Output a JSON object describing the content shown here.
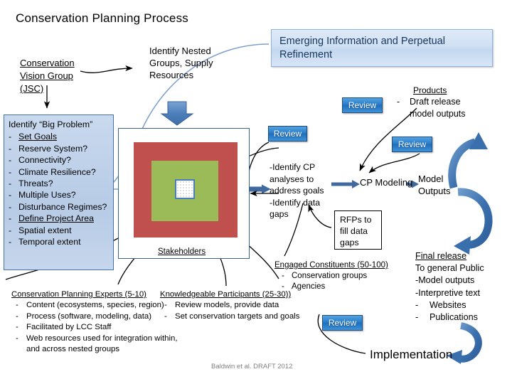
{
  "title": "Conservation Planning Process",
  "credit": "Baldwin et al. DRAFT 2012",
  "colors": {
    "red_square": "#C0504D",
    "green_square": "#9BBB59",
    "accent_blue": "#4A7EBB",
    "banner_text": "#16365C",
    "review_button": "#1F6FBE"
  },
  "vision_group": {
    "line1": "Conservation",
    "line2": "Vision Group",
    "line3": "(JSC)"
  },
  "nested_groups": {
    "line1": "Identify Nested",
    "line2": "Groups, Supply",
    "line3": "Resources"
  },
  "banner": {
    "text": "Emerging Information and Perpetual Refinement"
  },
  "big_problem": {
    "heading": "Identify “Big Problem”",
    "items": [
      {
        "dash": "-",
        "text": "Set Goals",
        "underline": true
      },
      {
        "dash": "-",
        "text": "Reserve System?",
        "underline": false
      },
      {
        "dash": "-",
        "text": "Connectivity?",
        "underline": false
      },
      {
        "dash": "-",
        "text": "Climate Resilience?",
        "underline": false
      },
      {
        "dash": "-",
        "text": "Threats?",
        "underline": false
      },
      {
        "dash": "-",
        "text": "Multiple Uses?",
        "underline": false
      },
      {
        "dash": "-",
        "text": "Disturbance Regimes?",
        "underline": false
      },
      {
        "dash": "-",
        "text": "Define Project Area",
        "underline": true
      },
      {
        "dash": "-",
        "text": "Spatial extent",
        "underline": false
      },
      {
        "dash": "-",
        "text": "Temporal extent",
        "underline": false
      }
    ]
  },
  "diagram": {
    "stakeholders_label": "Stakeholders"
  },
  "review_buttons": [
    {
      "label": "Review"
    },
    {
      "label": "Review"
    },
    {
      "label": "Review"
    },
    {
      "label": "Review"
    }
  ],
  "identify_cp": {
    "line1": "-Identify CP",
    "line2": "analyses to",
    "line3": "address goals",
    "line4": "-Identify data",
    "line5": "gaps"
  },
  "rfp_box": {
    "line1": "RFPs to",
    "line2": "fill data",
    "line3": "gaps"
  },
  "products": {
    "heading": "Products",
    "items": [
      {
        "dash": "-",
        "line1": "Draft release",
        "line2": "model outputs"
      }
    ]
  },
  "modeling": {
    "cp_modeling": "CP Modeling",
    "model_outputs_line1": "Model",
    "model_outputs_line2": "Outputs"
  },
  "engaged_constituents": {
    "heading": "Engaged Constituents (50-100)",
    "items": [
      {
        "dash": "-",
        "text": "Conservation groups"
      },
      {
        "dash": "-",
        "text": "Agencies"
      }
    ]
  },
  "final_release": {
    "heading": "Final release",
    "line1": "To general Public",
    "line2": "-Model outputs",
    "line3": "-Interpretive text",
    "items": [
      {
        "dash": "-",
        "text": "Websites"
      },
      {
        "dash": "-",
        "text": "Publications"
      }
    ]
  },
  "implementation": {
    "label": "Implementation"
  },
  "group_experts": {
    "heading": "Conservation Planning Experts (5-10)",
    "items": [
      {
        "dash": "-",
        "text": "Content (ecosystems, species, region)"
      },
      {
        "dash": "-",
        "text": "Process (software, modeling, data)"
      },
      {
        "dash": "-",
        "text": "Facilitated by LCC Staff"
      },
      {
        "dash": "-",
        "text": "Web resources used for integration within, and across nested groups"
      }
    ]
  },
  "group_participants": {
    "heading": "Knowledgeable Participants (25-30))",
    "items": [
      {
        "dash": "-",
        "text": "Review models, provide data"
      },
      {
        "dash": "-",
        "text": "Set conservation targets and goals"
      }
    ]
  }
}
